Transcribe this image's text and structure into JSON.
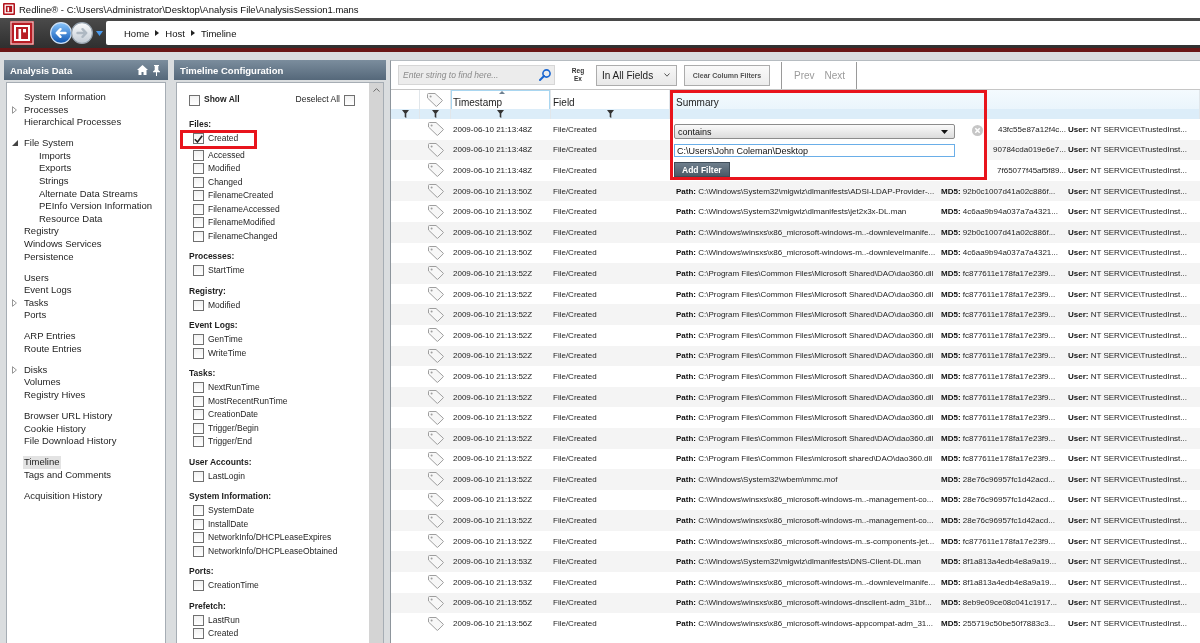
{
  "window": {
    "title": "Redline® - C:\\Users\\Administrator\\Desktop\\Analysis File\\AnalysisSession1.mans"
  },
  "navigation": {
    "buttons": [
      {
        "kind": "back",
        "disabled": false
      },
      {
        "kind": "forward",
        "disabled": true
      }
    ],
    "breadcrumb": [
      "Home",
      "Host",
      "Timeline"
    ]
  },
  "analysis_panel": {
    "title": "Analysis Data",
    "groups": [
      {
        "items": [
          {
            "label": "System Information",
            "selected": false
          },
          {
            "label": "Processes",
            "selected": false,
            "expanded": false
          },
          {
            "label": "Hierarchical Processes",
            "selected": false
          }
        ]
      },
      {
        "items": [
          {
            "label": "File System",
            "selected": false,
            "expanded": true,
            "children": [
              {
                "label": "Imports",
                "selected": false
              },
              {
                "label": "Exports",
                "selected": false
              },
              {
                "label": "Strings",
                "selected": false
              },
              {
                "label": "Alternate Data Streams",
                "selected": false
              },
              {
                "label": "PEInfo Version Information",
                "selected": false
              },
              {
                "label": "Resource Data",
                "selected": false
              }
            ]
          },
          {
            "label": "Registry",
            "selected": false
          },
          {
            "label": "Windows Services",
            "selected": false
          },
          {
            "label": "Persistence",
            "selected": false
          }
        ]
      },
      {
        "items": [
          {
            "label": "Users",
            "selected": false
          },
          {
            "label": "Event Logs",
            "selected": false
          },
          {
            "label": "Tasks",
            "selected": false,
            "expanded": false
          },
          {
            "label": "Ports",
            "selected": false
          }
        ]
      },
      {
        "items": [
          {
            "label": "ARP Entries",
            "selected": false
          },
          {
            "label": "Route Entries",
            "selected": false
          }
        ]
      },
      {
        "items": [
          {
            "label": "Disks",
            "selected": false,
            "expanded": false
          },
          {
            "label": "Volumes",
            "selected": false
          },
          {
            "label": "Registry Hives",
            "selected": false
          }
        ]
      },
      {
        "items": [
          {
            "label": "Browser URL History",
            "selected": false
          },
          {
            "label": "Cookie History",
            "selected": false
          },
          {
            "label": "File Download History",
            "selected": false
          }
        ]
      },
      {
        "items": [
          {
            "label": "Timeline",
            "selected": true
          },
          {
            "label": "Tags and Comments",
            "selected": false
          }
        ]
      },
      {
        "items": [
          {
            "label": "Acquisition History",
            "selected": false
          }
        ]
      }
    ]
  },
  "config_panel": {
    "title": "Timeline Configuration",
    "show_all": {
      "label": "Show All",
      "checked": false
    },
    "deselect_all": {
      "label": "Deselect All",
      "checked": false
    },
    "sections": [
      {
        "title": "Files:",
        "items": [
          {
            "label": "Created",
            "checked": true,
            "highlighted": true
          },
          {
            "label": "Accessed",
            "checked": false,
            "highlighted": false
          },
          {
            "label": "Modified",
            "checked": false,
            "highlighted": false
          },
          {
            "label": "Changed",
            "checked": false,
            "highlighted": false
          },
          {
            "label": "FilenameCreated",
            "checked": false,
            "highlighted": false
          },
          {
            "label": "FilenameAccessed",
            "checked": false,
            "highlighted": false
          },
          {
            "label": "FilenameModified",
            "checked": false,
            "highlighted": false
          },
          {
            "label": "FilenameChanged",
            "checked": false,
            "highlighted": false
          }
        ]
      },
      {
        "title": "Processes:",
        "items": [
          {
            "label": "StartTime",
            "checked": false,
            "highlighted": false
          }
        ]
      },
      {
        "title": "Registry:",
        "items": [
          {
            "label": "Modified",
            "checked": false,
            "highlighted": false
          }
        ]
      },
      {
        "title": "Event Logs:",
        "items": [
          {
            "label": "GenTime",
            "checked": false,
            "highlighted": false
          },
          {
            "label": "WriteTime",
            "checked": false,
            "highlighted": false
          }
        ]
      },
      {
        "title": "Tasks:",
        "items": [
          {
            "label": "NextRunTime",
            "checked": false,
            "highlighted": false
          },
          {
            "label": "MostRecentRunTime",
            "checked": false,
            "highlighted": false
          },
          {
            "label": "CreationDate",
            "checked": false,
            "highlighted": false
          },
          {
            "label": "Trigger/Begin",
            "checked": false,
            "highlighted": false
          },
          {
            "label": "Trigger/End",
            "checked": false,
            "highlighted": false
          }
        ]
      },
      {
        "title": "User Accounts:",
        "items": [
          {
            "label": "LastLogin",
            "checked": false,
            "highlighted": false
          }
        ]
      },
      {
        "title": "System Information:",
        "items": [
          {
            "label": "SystemDate",
            "checked": false,
            "highlighted": false
          },
          {
            "label": "InstallDate",
            "checked": false,
            "highlighted": false
          },
          {
            "label": "NetworkInfo/DHCPLeaseExpires",
            "checked": false,
            "highlighted": false
          },
          {
            "label": "NetworkInfo/DHCPLeaseObtained",
            "checked": false,
            "highlighted": false
          }
        ]
      },
      {
        "title": "Ports:",
        "items": [
          {
            "label": "CreationTime",
            "checked": false,
            "highlighted": false
          }
        ]
      },
      {
        "title": "Prefetch:",
        "items": [
          {
            "label": "LastRun",
            "checked": false,
            "highlighted": false
          },
          {
            "label": "Created",
            "checked": false,
            "highlighted": false
          }
        ]
      }
    ]
  },
  "toolbar": {
    "search": {
      "placeholder": "Enter string to find here..."
    },
    "regex_button": "Reg Ex",
    "scope": "In All Fields",
    "clear_button": "Clear Column Filters",
    "pager": [
      {
        "label": "Prev",
        "disabled": true
      },
      {
        "label": "Next",
        "disabled": true
      }
    ]
  },
  "table": {
    "columns": [
      {
        "kind": "blank",
        "filter_button": true
      },
      {
        "kind": "tag",
        "filter_button": true
      },
      {
        "kind": "text",
        "label": "Timestamp",
        "sorted": true,
        "filter_button": true
      },
      {
        "kind": "text",
        "label": "Field",
        "sorted": false,
        "filter_button": true
      },
      {
        "kind": "text",
        "label": "Summary",
        "sorted": false,
        "filter_button": false
      }
    ],
    "rows": [
      {
        "timestamp": "2009-06-10 21:13:48Z",
        "field": "File/Created",
        "md5": "43fc55e87a12f4c...",
        "user": "**User:** NT SERVICE\\TrustedInst..."
      },
      {
        "timestamp": "2009-06-10 21:13:48Z",
        "field": "File/Created",
        "md5": "90784cda019e6e7...",
        "user": "**User:** NT SERVICE\\TrustedInst..."
      },
      {
        "timestamp": "2009-06-10 21:13:48Z",
        "field": "File/Created",
        "md5": "7f65077f45af5f89...",
        "user": "**User:** NT SERVICE\\TrustedInst..."
      },
      {
        "timestamp": "2009-06-10 21:13:50Z",
        "field": "File/Created",
        "path": "**Path:** C:\\Windows\\System32\\migwiz\\dlmanifests\\ADSI-LDAP-Provider-...",
        "md5": "**MD5:** 92b0c1007d41a02c886f...",
        "user": "**User:** NT SERVICE\\TrustedInst..."
      },
      {
        "timestamp": "2009-06-10 21:13:50Z",
        "field": "File/Created",
        "path": "**Path:** C:\\Windows\\System32\\migwiz\\dlmanifests\\jet2x3x-DL.man",
        "md5": "**MD5:** 4c6aa9b94a037a7a4321...",
        "user": "**User:** NT SERVICE\\TrustedInst..."
      },
      {
        "timestamp": "2009-06-10 21:13:50Z",
        "field": "File/Created",
        "path": "**Path:** C:\\Windows\\winsxs\\x86_microsoft-windows-m..-downlevelmanife...",
        "md5": "**MD5:** 92b0c1007d41a02c886f...",
        "user": "**User:** NT SERVICE\\TrustedInst..."
      },
      {
        "timestamp": "2009-06-10 21:13:50Z",
        "field": "File/Created",
        "path": "**Path:** C:\\Windows\\winsxs\\x86_microsoft-windows-m..-downlevelmanife...",
        "md5": "**MD5:** 4c6aa9b94a037a7a4321...",
        "user": "**User:** NT SERVICE\\TrustedInst..."
      },
      {
        "timestamp": "2009-06-10 21:13:52Z",
        "field": "File/Created",
        "path": "**Path:** C:\\Program Files\\Common Files\\Microsoft Shared\\DAO\\dao360.dll",
        "md5": "**MD5:** fc877611e178fa17e23f9...",
        "user": "**User:** NT SERVICE\\TrustedInst..."
      },
      {
        "timestamp": "2009-06-10 21:13:52Z",
        "field": "File/Created",
        "path": "**Path:** C:\\Program Files\\Common Files\\Microsoft Shared\\DAO\\dao360.dll",
        "md5": "**MD5:** fc877611e178fa17e23f9...",
        "user": "**User:** NT SERVICE\\TrustedInst..."
      },
      {
        "timestamp": "2009-06-10 21:13:52Z",
        "field": "File/Created",
        "path": "**Path:** C:\\Program Files\\Common Files\\Microsoft Shared\\DAO\\dao360.dll",
        "md5": "**MD5:** fc877611e178fa17e23f9...",
        "user": "**User:** NT SERVICE\\TrustedInst..."
      },
      {
        "timestamp": "2009-06-10 21:13:52Z",
        "field": "File/Created",
        "path": "**Path:** C:\\Program Files\\Common Files\\Microsoft Shared\\DAO\\dao360.dll",
        "md5": "**MD5:** fc877611e178fa17e23f9...",
        "user": "**User:** NT SERVICE\\TrustedInst..."
      },
      {
        "timestamp": "2009-06-10 21:13:52Z",
        "field": "File/Created",
        "path": "**Path:** C:\\Program Files\\Common Files\\Microsoft Shared\\DAO\\dao360.dll",
        "md5": "**MD5:** fc877611e178fa17e23f9...",
        "user": "**User:** NT SERVICE\\TrustedInst..."
      },
      {
        "timestamp": "2009-06-10 21:13:52Z",
        "field": "File/Created",
        "path": "**Path:** C:\\Program Files\\Common Files\\Microsoft Shared\\DAO\\dao360.dll",
        "md5": "**MD5:** fc877611e178fa17e23f9...",
        "user": "**User:** NT SERVICE\\TrustedInst..."
      },
      {
        "timestamp": "2009-06-10 21:13:52Z",
        "field": "File/Created",
        "path": "**Path:** C:\\Program Files\\Common Files\\Microsoft Shared\\DAO\\dao360.dll",
        "md5": "**MD5:** fc877611e178fa17e23f9...",
        "user": "**User:** NT SERVICE\\TrustedInst..."
      },
      {
        "timestamp": "2009-06-10 21:13:52Z",
        "field": "File/Created",
        "path": "**Path:** C:\\Program Files\\Common Files\\Microsoft Shared\\DAO\\dao360.dll",
        "md5": "**MD5:** fc877611e178fa17e23f9...",
        "user": "**User:** NT SERVICE\\TrustedInst..."
      },
      {
        "timestamp": "2009-06-10 21:13:52Z",
        "field": "File/Created",
        "path": "**Path:** C:\\Program Files\\Common Files\\Microsoft Shared\\DAO\\dao360.dll",
        "md5": "**MD5:** fc877611e178fa17e23f9...",
        "user": "**User:** NT SERVICE\\TrustedInst..."
      },
      {
        "timestamp": "2009-06-10 21:13:52Z",
        "field": "File/Created",
        "path": "**Path:** C:\\Program Files\\Common Files\\microsoft shared\\DAO\\dao360.dll",
        "md5": "**MD5:** fc877611e178fa17e23f9...",
        "user": "**User:** NT SERVICE\\TrustedInst..."
      },
      {
        "timestamp": "2009-06-10 21:13:52Z",
        "field": "File/Created",
        "path": "**Path:** C:\\Windows\\System32\\wbem\\mmc.mof",
        "md5": "**MD5:** 28e76c96957fc1d42acd...",
        "user": "**User:** NT SERVICE\\TrustedInst..."
      },
      {
        "timestamp": "2009-06-10 21:13:52Z",
        "field": "File/Created",
        "path": "**Path:** C:\\Windows\\winsxs\\x86_microsoft-windows-m..-management-co...",
        "md5": "**MD5:** 28e76c96957fc1d42acd...",
        "user": "**User:** NT SERVICE\\TrustedInst..."
      },
      {
        "timestamp": "2009-06-10 21:13:52Z",
        "field": "File/Created",
        "path": "**Path:** C:\\Windows\\winsxs\\x86_microsoft-windows-m..-management-co...",
        "md5": "**MD5:** 28e76c96957fc1d42acd...",
        "user": "**User:** NT SERVICE\\TrustedInst..."
      },
      {
        "timestamp": "2009-06-10 21:13:52Z",
        "field": "File/Created",
        "path": "**Path:** C:\\Windows\\winsxs\\x86_microsoft-windows-m..s-components-jet...",
        "md5": "**MD5:** fc877611e178fa17e23f9...",
        "user": "**User:** NT SERVICE\\TrustedInst..."
      },
      {
        "timestamp": "2009-06-10 21:13:53Z",
        "field": "File/Created",
        "path": "**Path:** C:\\Windows\\System32\\migwiz\\dlmanifests\\DNS-Client-DL.man",
        "md5": "**MD5:** 8f1a813a4edb4e8a9a19...",
        "user": "**User:** NT SERVICE\\TrustedInst..."
      },
      {
        "timestamp": "2009-06-10 21:13:53Z",
        "field": "File/Created",
        "path": "**Path:** C:\\Windows\\winsxs\\x86_microsoft-windows-m..-downlevelmanife...",
        "md5": "**MD5:** 8f1a813a4edb4e8a9a19...",
        "user": "**User:** NT SERVICE\\TrustedInst..."
      },
      {
        "timestamp": "2009-06-10 21:13:55Z",
        "field": "File/Created",
        "path": "**Path:** C:\\Windows\\winsxs\\x86_microsoft-windows-dnsclient-adm_31bf...",
        "md5": "**MD5:** 8eb9e09ce08c041c1917...",
        "user": "**User:** NT SERVICE\\TrustedInst..."
      },
      {
        "timestamp": "2009-06-10 21:13:56Z",
        "field": "File/Created",
        "path": "**Path:** C:\\Windows\\winsxs\\x86_microsoft-windows-appcompat-adm_31...",
        "md5": "**MD5:** 255719c50be50f7883c3...",
        "user": "**User:** NT SERVICE\\TrustedInst..."
      }
    ],
    "filter_popup": {
      "operator": "contains",
      "value": "C:\\Users\\John Coleman\\Desktop",
      "button": "Add Filter",
      "highlighted": true
    }
  }
}
